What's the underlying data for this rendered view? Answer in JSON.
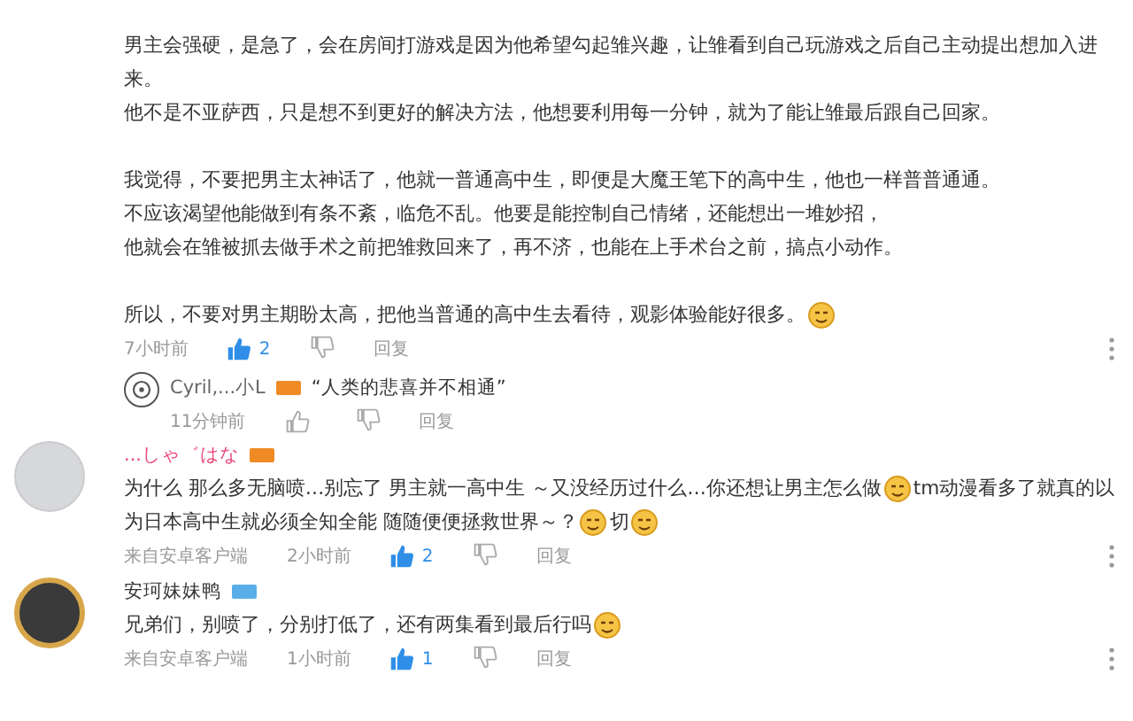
{
  "comments": [
    {
      "paragraphs": [
        [
          [
            {
              "kind": "text",
              "text": "男主会强硬，是急了，会在房间打游戏是因为他希望勾起雏兴趣，让雏看到自己玩游戏之后自己主动提出想加入进"
            }
          ],
          [
            {
              "kind": "text",
              "text": "来。"
            }
          ],
          [
            {
              "kind": "text",
              "text": "他不是不亚萨西，只是想不到更好的解决方法，他想要利用每一分钟，就为了能让雏最后跟自己回家。"
            }
          ]
        ],
        [
          [
            {
              "kind": "text",
              "text": "我觉得，不要把男主太神话了，他就一普通高中生，即便是大魔王笔下的高中生，他也一样普普通通。"
            }
          ],
          [
            {
              "kind": "text",
              "text": "不应该渴望他能做到有条不紊，临危不乱。他要是能控制自己情绪，还能想出一堆妙招，"
            }
          ],
          [
            {
              "kind": "text",
              "text": "他就会在雏被抓去做手术之前把雏救回来了，再不济，也能在上手术台之前，搞点小动作。"
            }
          ]
        ],
        [
          [
            {
              "kind": "text",
              "text": "所以，不要对男主期盼太高，把他当普通的高中生去看待，观影体验能好很多。"
            },
            {
              "kind": "emoji"
            }
          ]
        ]
      ],
      "time": "7小时前",
      "likes": "2",
      "liked": true,
      "reply_label": "回复",
      "replies": [
        {
          "name": "Cyril,...小L",
          "color": "#f08a24",
          "text": "“人类的悲喜并不相通”",
          "time": "11分钟前",
          "reply_label": "回复"
        }
      ]
    },
    {
      "name": "...しゃ゛はな",
      "highlighted_name": true,
      "avatar_frame": false,
      "color": "#f08a24",
      "paragraphs": [
        [
          [
            {
              "kind": "text",
              "text": "为什么 那么多无脑喷…别忘了 男主就一高中生 ～又没经历过什么…你还想让男主怎么做"
            },
            {
              "kind": "emoji"
            },
            {
              "kind": "text",
              "text": "tm动漫看多了就真的以"
            }
          ],
          [
            {
              "kind": "text",
              "text": "为日本高中生就必须全知全能 随随便便拯救世界～？"
            },
            {
              "kind": "emoji"
            },
            {
              "kind": "text",
              "text": " 切"
            },
            {
              "kind": "emoji"
            }
          ]
        ]
      ],
      "source": "来自安卓客户端",
      "time": "2小时前",
      "likes": "2",
      "liked": true,
      "reply_label": "回复"
    },
    {
      "name": "安珂妹妹鸭",
      "highlighted_name": false,
      "avatar_frame": true,
      "color": "#5aaee8",
      "paragraphs": [
        [
          [
            {
              "kind": "text",
              "text": "兄弟们，别喷了，分别打低了，还有两集看到最后行吗"
            },
            {
              "kind": "emoji"
            }
          ]
        ]
      ],
      "source": "来自安卓客户端",
      "time": "1小时前",
      "likes": "1",
      "liked": true,
      "reply_label": "回复"
    }
  ]
}
